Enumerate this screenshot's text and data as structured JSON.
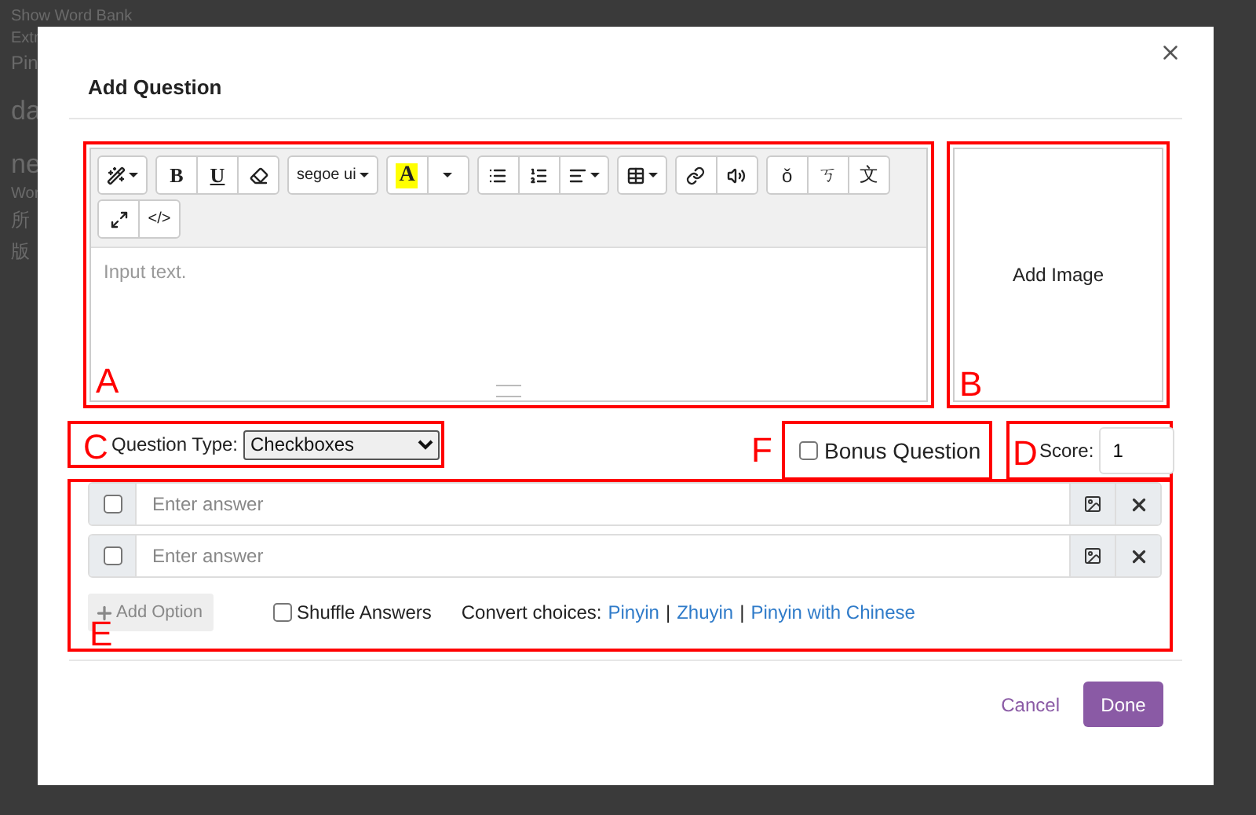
{
  "background": {
    "texts": [
      {
        "kind": "small",
        "text": "Show Word Bank"
      },
      {
        "kind": "small",
        "text": "Extr"
      },
      {
        "kind": "medium",
        "text": "Pin"
      },
      {
        "kind": "large",
        "text": "da"
      },
      {
        "kind": "large",
        "text": "ne"
      },
      {
        "kind": "small",
        "text": "Wor"
      },
      {
        "kind": "medium",
        "text": "所"
      },
      {
        "kind": "medium",
        "text": "版"
      }
    ]
  },
  "dialog": {
    "title": "Add Question",
    "editor": {
      "annotation": "A",
      "placeholder": "Input text.",
      "toolbar": [
        [
          {
            "kind": "wand",
            "caret": true
          }
        ],
        [
          {
            "kind": "bold",
            "label": "B"
          },
          {
            "kind": "underline",
            "label": "U"
          },
          {
            "kind": "eraser"
          }
        ],
        [
          {
            "kind": "font",
            "label": "segoe ui",
            "caret": true
          }
        ],
        [
          {
            "kind": "highlight",
            "label": "A"
          },
          {
            "kind": "caret"
          }
        ],
        [
          {
            "kind": "ul"
          },
          {
            "kind": "ol"
          },
          {
            "kind": "align",
            "caret": true
          }
        ],
        [
          {
            "kind": "table",
            "caret": true
          }
        ],
        [
          {
            "kind": "link"
          },
          {
            "kind": "sound"
          }
        ],
        [
          {
            "kind": "glyph",
            "label": "ǒ"
          },
          {
            "kind": "glyph",
            "label": "ㄎ"
          },
          {
            "kind": "glyph",
            "label": "文"
          }
        ],
        [
          {
            "kind": "fullscreen"
          },
          {
            "kind": "code",
            "label": "</>"
          }
        ]
      ]
    },
    "image_panel": {
      "annotation": "B",
      "label": "Add Image"
    },
    "question_type": {
      "annotation": "C",
      "label": "Question Type:",
      "value": "Checkboxes"
    },
    "bonus": {
      "annotation": "F",
      "label": "Bonus Question",
      "checked": false
    },
    "score": {
      "annotation": "D",
      "label": "Score:",
      "value": "1"
    },
    "answers": {
      "annotation": "E",
      "items": [
        {
          "placeholder": "Enter answer",
          "checked": false
        },
        {
          "placeholder": "Enter answer",
          "checked": false
        }
      ],
      "add_option": "Add Option",
      "shuffle": {
        "label": "Shuffle Answers",
        "checked": false
      },
      "convert": {
        "label": "Convert choices:",
        "links": [
          "Pinyin",
          "Zhuyin",
          "Pinyin with Chinese"
        ],
        "separators": [
          "|",
          "|"
        ]
      }
    },
    "buttons": {
      "cancel": "Cancel",
      "done": "Done"
    }
  }
}
